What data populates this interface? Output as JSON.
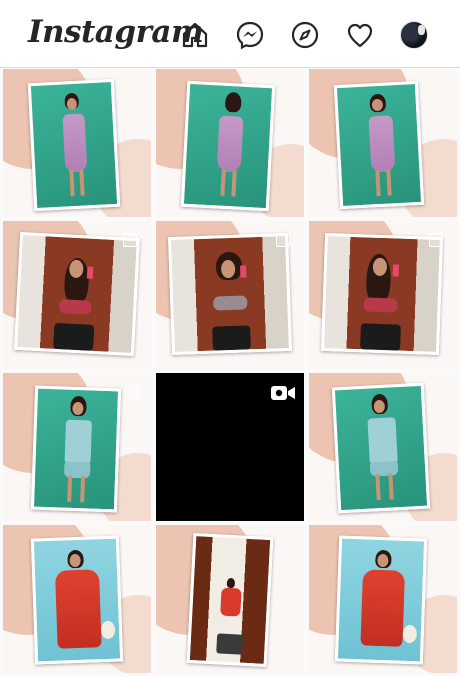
{
  "header": {
    "logo_text": "Instagram",
    "nav": [
      {
        "name": "home-icon"
      },
      {
        "name": "messenger-icon"
      },
      {
        "name": "explore-compass-icon"
      },
      {
        "name": "activity-heart-icon"
      },
      {
        "name": "profile-avatar"
      }
    ]
  },
  "grid": {
    "columns": 3,
    "rows": 4,
    "posts": [
      {
        "index": 1,
        "kind": "photo",
        "background": "teal",
        "outfit": "floral-slip-dress",
        "multi": false
      },
      {
        "index": 2,
        "kind": "photo",
        "background": "teal",
        "outfit": "floral-slip-dress-back",
        "multi": false
      },
      {
        "index": 3,
        "kind": "photo",
        "background": "teal",
        "outfit": "floral-slip-dress",
        "multi": false
      },
      {
        "index": 4,
        "kind": "photo",
        "background": "mirror-selfie",
        "outfit": "bralette-set",
        "multi": true
      },
      {
        "index": 5,
        "kind": "photo",
        "background": "mirror-selfie",
        "outfit": "bralette-set",
        "multi": true
      },
      {
        "index": 6,
        "kind": "photo",
        "background": "mirror-selfie",
        "outfit": "bralette-set",
        "multi": true
      },
      {
        "index": 7,
        "kind": "photo",
        "background": "teal",
        "outfit": "blue-cami-set",
        "multi": true
      },
      {
        "index": 8,
        "kind": "video",
        "background": "black",
        "outfit": "",
        "multi": false
      },
      {
        "index": 9,
        "kind": "photo",
        "background": "teal",
        "outfit": "blue-cami-set",
        "multi": false
      },
      {
        "index": 10,
        "kind": "photo",
        "background": "sky",
        "outfit": "red-satin-robe",
        "multi": false
      },
      {
        "index": 11,
        "kind": "photo",
        "background": "doorway",
        "outfit": "red-satin-robe",
        "multi": false
      },
      {
        "index": 12,
        "kind": "photo",
        "background": "sky",
        "outfit": "red-satin-robe",
        "multi": false
      }
    ]
  },
  "colors": {
    "header_bg": "#ffffff",
    "border": "#dbdbdb",
    "icon": "#262626",
    "tile_blob": "#ecc4b1",
    "teal": "#2fa68b",
    "sky": "#7ccbd9",
    "robe_red": "#d83a2c",
    "video_bg": "#000000"
  }
}
